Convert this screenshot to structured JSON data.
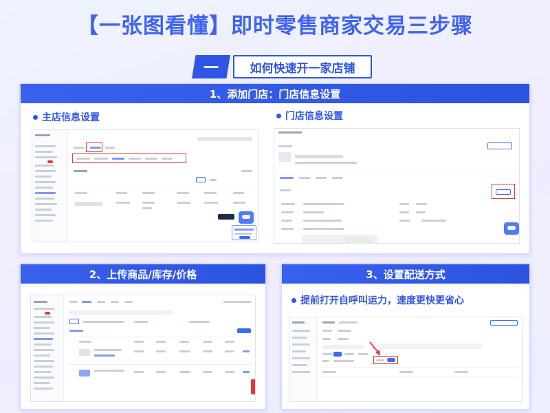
{
  "title": "【一张图看懂】即时零售商家交易三步骤",
  "section": {
    "number": "一",
    "label": "如何快速开一家店铺"
  },
  "step1": {
    "heading": "1、添加门店：门店信息设置",
    "left_label": "主店信息设置",
    "right_label": "门店信息设置"
  },
  "step2": {
    "heading": "2、上传商品/库存/价格"
  },
  "step3": {
    "heading": "3、设置配送方式",
    "tip": "提前打开自呼叫运力，速度更快更省心"
  },
  "colors": {
    "accent": "#2f55e6",
    "highlight": "#e53935"
  }
}
